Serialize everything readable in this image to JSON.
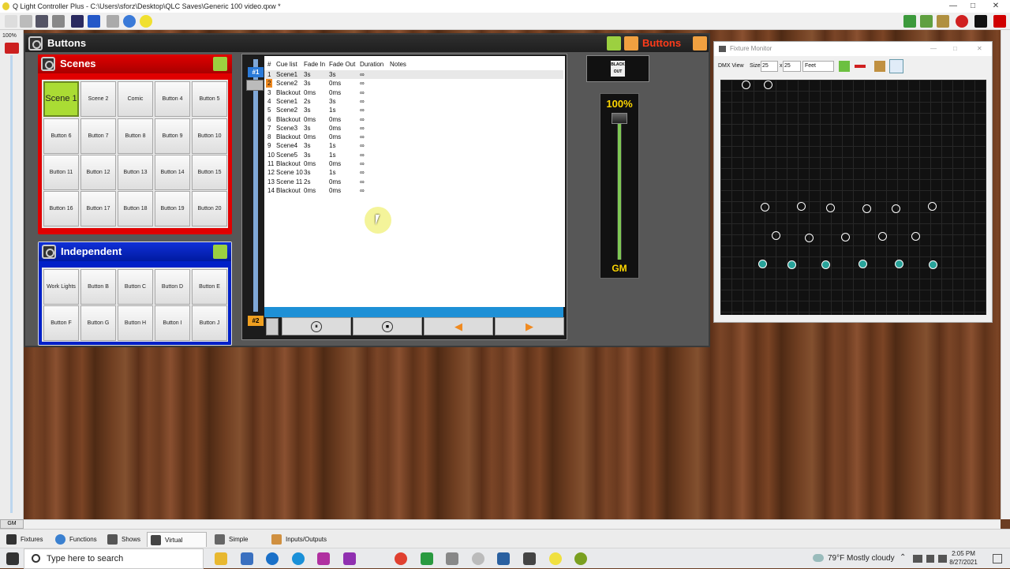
{
  "window": {
    "title": "Q Light Controller Plus - C:\\Users\\sforz\\Desktop\\QLC Saves\\Generic 100 video.qxw *",
    "minimize": "—",
    "maximize": "□",
    "close": "✕"
  },
  "left_strip": {
    "percent": "100%",
    "gm": "GM"
  },
  "buttons_frame": {
    "title": "Buttons",
    "page_label": "Buttons"
  },
  "scenes_frame": {
    "title": "Scenes",
    "buttons": [
      "Scene 1",
      "Scene 2",
      "Comic",
      "Button 4",
      "Button 5",
      "Button 6",
      "Button 7",
      "Button 8",
      "Button 9",
      "Button 10",
      "Button 11",
      "Button 12",
      "Button 13",
      "Button 14",
      "Button 15",
      "Button 16",
      "Button 17",
      "Button 18",
      "Button 19",
      "Button 20"
    ]
  },
  "independent_frame": {
    "title": "Independent",
    "buttons": [
      "Work Lights",
      "Button B",
      "Button C",
      "Button D",
      "Button E",
      "Button F",
      "Button G",
      "Button H",
      "Button I",
      "Button J"
    ]
  },
  "cuelist": {
    "marker1": "#1",
    "marker2": "#2",
    "headers": {
      "num": "#",
      "name": "Cue list",
      "fade_in": "Fade In",
      "fade_out": "Fade Out",
      "duration": "Duration",
      "notes": "Notes"
    },
    "rows": [
      {
        "n": "1",
        "name": "Scene1",
        "fi": "3s",
        "fo": "3s",
        "d": "∞"
      },
      {
        "n": "2",
        "name": "Scene2",
        "fi": "3s",
        "fo": "0ms",
        "d": "∞"
      },
      {
        "n": "3",
        "name": "Blackout",
        "fi": "0ms",
        "fo": "0ms",
        "d": "∞"
      },
      {
        "n": "4",
        "name": "Scene1",
        "fi": "2s",
        "fo": "3s",
        "d": "∞"
      },
      {
        "n": "5",
        "name": "Scene2",
        "fi": "3s",
        "fo": "1s",
        "d": "∞"
      },
      {
        "n": "6",
        "name": "Blackout",
        "fi": "0ms",
        "fo": "0ms",
        "d": "∞"
      },
      {
        "n": "7",
        "name": "Scene3",
        "fi": "3s",
        "fo": "0ms",
        "d": "∞"
      },
      {
        "n": "8",
        "name": "Blackout",
        "fi": "0ms",
        "fo": "0ms",
        "d": "∞"
      },
      {
        "n": "9",
        "name": "Scene4",
        "fi": "3s",
        "fo": "1s",
        "d": "∞"
      },
      {
        "n": "10",
        "name": "Scene5",
        "fi": "3s",
        "fo": "1s",
        "d": "∞"
      },
      {
        "n": "11",
        "name": "Blackout",
        "fi": "0ms",
        "fo": "0ms",
        "d": "∞"
      },
      {
        "n": "12",
        "name": "Scene 10",
        "fi": "3s",
        "fo": "1s",
        "d": "∞"
      },
      {
        "n": "13",
        "name": "Scene 11",
        "fi": "2s",
        "fo": "0ms",
        "d": "∞"
      },
      {
        "n": "14",
        "name": "Blackout",
        "fi": "0ms",
        "fo": "0ms",
        "d": "∞"
      }
    ],
    "controls": {
      "pause": "⏸",
      "stop": "⏹",
      "prev": "◀",
      "next": "▶"
    }
  },
  "blackout": {
    "label_line1": "BLACK",
    "label_line2": "OUT"
  },
  "grandmaster": {
    "percent": "100%",
    "label": "GM",
    "level": 1.0
  },
  "fixture_monitor": {
    "title": "Fixture Monitor",
    "dmx_view": "DMX View",
    "size_label": "Size",
    "size_x": "25",
    "x_sep": "x",
    "size_y": "25",
    "units": "Feet"
  },
  "bottom_tabs": [
    "Fixtures",
    "Functions",
    "Shows",
    "Virtual Console",
    "Simple Desk",
    "Inputs/Outputs"
  ],
  "taskbar": {
    "search_placeholder": "Type here to search",
    "weather": "79°F  Mostly cloudy",
    "time": "2:05 PM",
    "date": "8/27/2021"
  },
  "colors": {
    "scenes_border": "#e00000",
    "independent_border": "#0020c8",
    "active_button": "#aadc34",
    "cue_bar": "#1e90d6",
    "fixture_on": "#29a39a"
  }
}
